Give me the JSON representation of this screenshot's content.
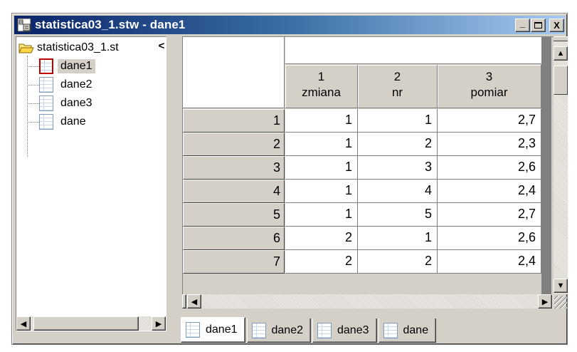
{
  "window": {
    "title": "statistica03_1.stw - dane1",
    "controls": {
      "minimize": "_",
      "maximize": "□",
      "close": "X"
    },
    "title_gradient": [
      "#0a246a",
      "#a6caf0"
    ]
  },
  "tree": {
    "root_label": "statistica03_1.st",
    "root_truncation": "<",
    "items": [
      {
        "label": "dane1",
        "selected": true
      },
      {
        "label": "dane2",
        "selected": false
      },
      {
        "label": "dane3",
        "selected": false
      },
      {
        "label": "dane",
        "selected": false
      }
    ]
  },
  "grid": {
    "columns": [
      {
        "number": "1",
        "name": "zmiana"
      },
      {
        "number": "2",
        "name": "nr"
      },
      {
        "number": "3",
        "name": "pomiar"
      }
    ],
    "rows": [
      {
        "label": "1",
        "cells": [
          "1",
          "1",
          "2,7"
        ]
      },
      {
        "label": "2",
        "cells": [
          "1",
          "2",
          "2,3"
        ]
      },
      {
        "label": "3",
        "cells": [
          "1",
          "3",
          "2,6"
        ]
      },
      {
        "label": "4",
        "cells": [
          "1",
          "4",
          "2,4"
        ]
      },
      {
        "label": "5",
        "cells": [
          "1",
          "5",
          "2,7"
        ]
      },
      {
        "label": "6",
        "cells": [
          "2",
          "1",
          "2,6"
        ]
      },
      {
        "label": "7",
        "cells": [
          "2",
          "2",
          "2,4"
        ]
      }
    ]
  },
  "tabs": [
    {
      "label": "dane1",
      "active": true
    },
    {
      "label": "dane2",
      "active": false
    },
    {
      "label": "dane3",
      "active": false
    },
    {
      "label": "dane",
      "active": false
    }
  ],
  "scroll_arrows": {
    "left": "◀",
    "right": "▶",
    "up": "▲",
    "down": "▼"
  }
}
